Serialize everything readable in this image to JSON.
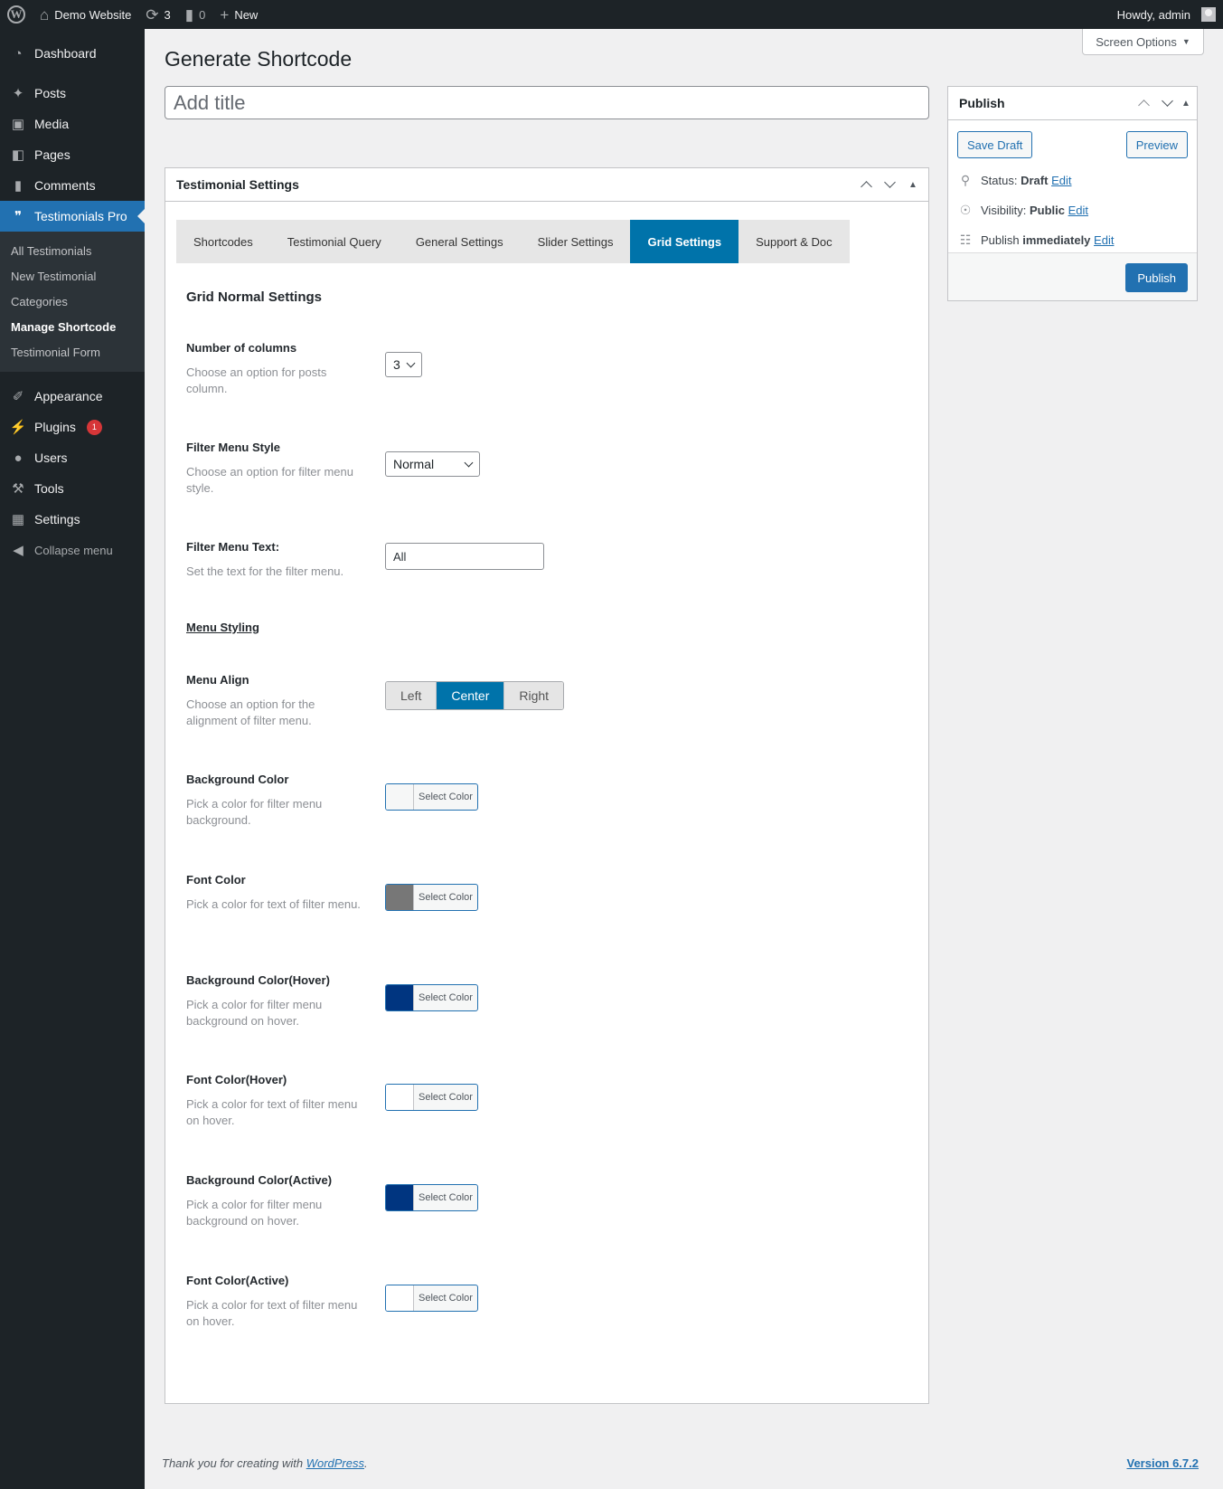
{
  "adminbar": {
    "site_name": "Demo Website",
    "updates_count": "3",
    "comments_count": "0",
    "new_label": "New",
    "howdy": "Howdy, admin"
  },
  "sidebar": {
    "items": [
      {
        "label": "Dashboard",
        "icon": "dashboard-icon"
      },
      {
        "label": "Posts",
        "icon": "pin-icon"
      },
      {
        "label": "Media",
        "icon": "media-icon"
      },
      {
        "label": "Pages",
        "icon": "pages-icon"
      },
      {
        "label": "Comments",
        "icon": "comment-icon"
      },
      {
        "label": "Testimonials Pro",
        "icon": "testimonial-icon"
      }
    ],
    "submenu": [
      "All Testimonials",
      "New Testimonial",
      "Categories",
      "Manage Shortcode",
      "Testimonial Form"
    ],
    "items_bottom": [
      {
        "label": "Appearance",
        "icon": "brush-icon"
      },
      {
        "label": "Plugins",
        "icon": "plugin-icon",
        "badge": "1"
      },
      {
        "label": "Users",
        "icon": "user-icon"
      },
      {
        "label": "Tools",
        "icon": "wrench-icon"
      },
      {
        "label": "Settings",
        "icon": "settings-icon"
      },
      {
        "label": "Collapse menu",
        "icon": "collapse-icon"
      }
    ]
  },
  "screen_options": "Screen Options",
  "page_title": "Generate Shortcode",
  "title_input": {
    "placeholder": "Add title",
    "value": ""
  },
  "settings_box": {
    "title": "Testimonial Settings",
    "tabs": [
      "Shortcodes",
      "Testimonial Query",
      "General Settings",
      "Slider Settings",
      "Grid Settings",
      "Support & Doc"
    ],
    "active_tab": "Grid Settings",
    "section_title": "Grid Normal Settings",
    "fields": {
      "columns": {
        "label": "Number of columns",
        "desc": "Choose an option for posts column.",
        "value": "3"
      },
      "filter_style": {
        "label": "Filter Menu Style",
        "desc": "Choose an option for filter menu style.",
        "value": "Normal"
      },
      "filter_text": {
        "label": "Filter Menu Text:",
        "desc": "Set the text for the filter menu.",
        "value": "All"
      },
      "menu_styling": "Menu Styling",
      "menu_align": {
        "label": "Menu Align",
        "desc": "Choose an option for the alignment of filter menu.",
        "options": [
          "Left",
          "Center",
          "Right"
        ],
        "selected": "Center"
      }
    },
    "color_button_label": "Select Color",
    "colors": [
      {
        "label": "Background Color",
        "desc": "Pick a color for filter menu background.",
        "color": "#f6f7f7"
      },
      {
        "label": "Font Color",
        "desc": "Pick a color for text of filter menu.",
        "color": "#777777"
      },
      {
        "label": "Background Color(Hover)",
        "desc": "Pick a color for filter menu background on hover.",
        "color": "#003580"
      },
      {
        "label": "Font Color(Hover)",
        "desc": "Pick a color for text of filter menu on hover.",
        "color": "#ffffff"
      },
      {
        "label": "Background Color(Active)",
        "desc": "Pick a color for filter menu background on hover.",
        "color": "#003580"
      },
      {
        "label": "Font Color(Active)",
        "desc": "Pick a color for text of filter menu on hover.",
        "color": "#ffffff"
      }
    ]
  },
  "publish": {
    "title": "Publish",
    "save_draft": "Save Draft",
    "preview": "Preview",
    "status_label": "Status:",
    "status_value": "Draft",
    "visibility_label": "Visibility:",
    "visibility_value": "Public",
    "publish_label": "Publish",
    "publish_when": "immediately",
    "edit": "Edit",
    "publish_button": "Publish"
  },
  "footer": {
    "thanks_prefix": "Thank you for creating with ",
    "thanks_link": "WordPress",
    "thanks_suffix": ".",
    "version": "Version 6.7.2"
  },
  "colors": {
    "accent": "#2271b1",
    "tab_active": "#0073aa",
    "adminbar_bg": "#1d2327"
  }
}
